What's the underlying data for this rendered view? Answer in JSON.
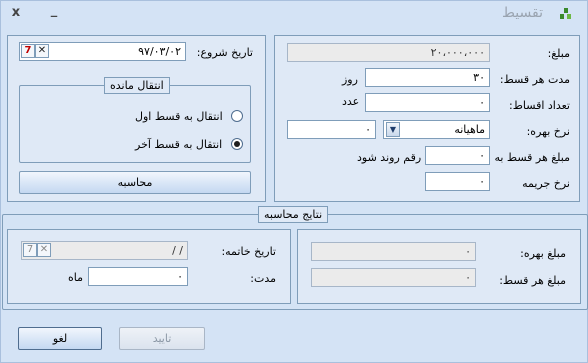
{
  "window": {
    "title": "تقسیط",
    "minimize_glyph": "_",
    "close_glyph": "x"
  },
  "right_panel": {
    "amount_label": "مبلغ:",
    "amount_value": "۲۰،۰۰۰،۰۰۰",
    "period_label": "مدت هر قسط:",
    "period_value": "۳۰",
    "period_unit": "روز",
    "count_label": "تعداد اقساط:",
    "count_value": "۰",
    "count_unit": "عدد",
    "rate_label": "نرخ بهره:",
    "rate_type_value": "ماهیانه",
    "rate_value": "۰",
    "rounding_label": "مبلغ هر قسط به",
    "rounding_value": "۰",
    "rounding_unit": "رقم روند شود",
    "penalty_label": "نرخ جریمه",
    "penalty_value": "۰"
  },
  "left_panel": {
    "start_date_label": "تاریخ شروع:",
    "start_date_value": "۹۷/۰۳/۰۲",
    "remainder_group_title": "انتقال مانده",
    "radio_first": "انتقال به قسط اول",
    "radio_last": "انتقال به قسط آخر",
    "selected": "last",
    "calculate_button": "محاسبه"
  },
  "results": {
    "group_title": "نتایج محاسبه",
    "interest_label": "مبلغ بهره:",
    "interest_value": "۰",
    "installment_label": "مبلغ هر قسط:",
    "installment_value": "۰",
    "end_date_label": "تاریخ خاتمه:",
    "end_date_value": "/    /",
    "duration_label": "مدت:",
    "duration_value": "۰",
    "duration_unit": "ماه"
  },
  "footer": {
    "cancel_button": "لغو",
    "confirm_button": "تایید"
  },
  "colors": {
    "window_bg": "#d4e3f5",
    "panel_bg": "#dfe9f6",
    "border": "#7f9db9"
  }
}
